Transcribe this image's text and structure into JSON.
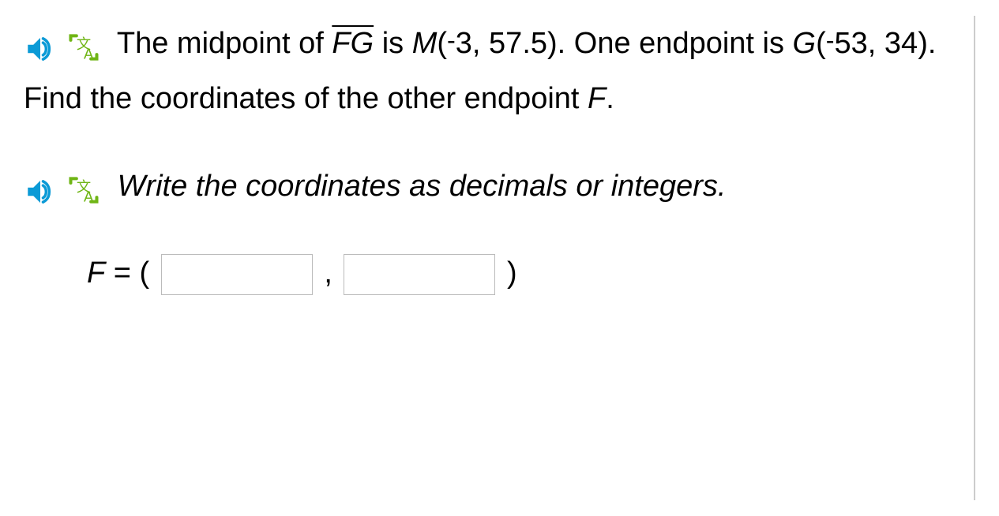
{
  "question": {
    "text_part1": "The midpoint of ",
    "segment": "FG",
    "text_part2": " is ",
    "midpoint_var": "M",
    "midpoint_coords": "(-3, 57.5)",
    "midpoint_x_neg": "-",
    "midpoint_x": "3",
    "midpoint_y": "57.5",
    "text_part3": ". One endpoint is ",
    "endpoint_var": "G",
    "endpoint_x_neg": "-",
    "endpoint_x": "53",
    "endpoint_y": "34",
    "text_part4": ". Find the coordinates of the other endpoint ",
    "find_var": "F",
    "text_part5": "."
  },
  "instruction": {
    "text": "Write the coordinates as decimals or integers."
  },
  "answer": {
    "var": "F",
    "equals": " = (",
    "comma": ",",
    "close": ")",
    "x_value": "",
    "y_value": ""
  }
}
